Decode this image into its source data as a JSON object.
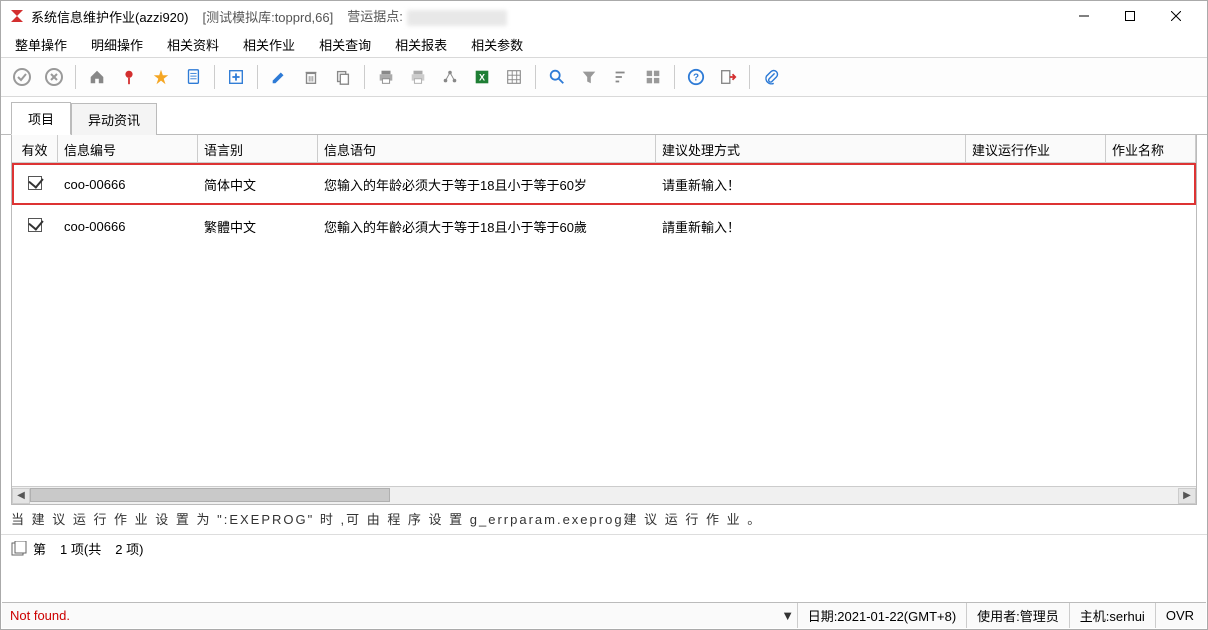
{
  "window": {
    "title": "系统信息维护作业(azzi920)",
    "db": "[测试模拟库:topprd,66]",
    "site_label": "营运据点:"
  },
  "menu": [
    "整单操作",
    "明细操作",
    "相关资料",
    "相关作业",
    "相关查询",
    "相关报表",
    "相关参数"
  ],
  "tabs": {
    "items": [
      "项目",
      "异动资讯"
    ],
    "active": 0
  },
  "columns": [
    "有效",
    "信息编号",
    "语言别",
    "信息语句",
    "建议处理方式",
    "建议运行作业",
    "作业名称"
  ],
  "rows": [
    {
      "checked": true,
      "code": "coo-00666",
      "lang": "简体中文",
      "msg": "您输入的年龄必须大于等于18且小于等于60岁",
      "suggest": "请重新输入！",
      "highlight": true
    },
    {
      "checked": true,
      "code": "coo-00666",
      "lang": "繁體中文",
      "msg": "您輸入的年齡必須大于等于18且小于等于60歲",
      "suggest": "請重新輸入！",
      "highlight": false
    }
  ],
  "hint": "当 建 议 运 行 作 业 设 置 为 \":EXEPROG\" 时 ,可 由 程 序 设 置 g_errparam.exeprog建 议 运 行 作 业 。",
  "pager": {
    "prefix": "第",
    "current": "1",
    "mid": "项(共",
    "total": "2",
    "suffix": "项)"
  },
  "status": {
    "msg": "Not found.",
    "date": "日期:2021-01-22(GMT+8)",
    "user": "使用者:管理员",
    "host": "主机:serhui",
    "mode": "OVR"
  }
}
